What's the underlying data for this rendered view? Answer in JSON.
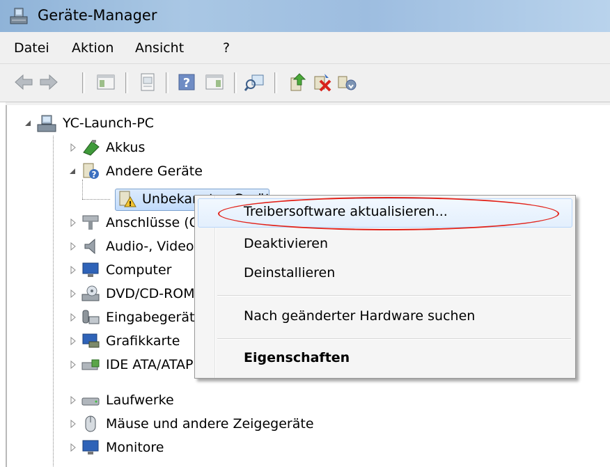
{
  "window": {
    "title": "Geräte-Manager",
    "icon": "device-manager-icon"
  },
  "menubar": {
    "items": [
      "Datei",
      "Aktion",
      "Ansicht",
      "?"
    ]
  },
  "toolbar": {
    "buttons": [
      "back-arrow-icon",
      "forward-arrow-icon",
      "show-hide-console-tree-icon",
      "properties-icon",
      "help-icon",
      "show-action-pane-icon",
      "scan-hardware-icon",
      "update-driver-icon",
      "disable-device-icon",
      "uninstall-device-icon"
    ]
  },
  "tree": {
    "root": "YC-Launch-PC",
    "nodes": [
      {
        "label": "Akkus",
        "icon": "battery-icon"
      },
      {
        "label": "Andere Geräte",
        "icon": "unknown-device-icon",
        "expanded": true
      },
      {
        "label": "Unbekanntes Gerät",
        "icon": "warning-device-icon",
        "selected": true
      },
      {
        "label": "Anschlüsse (COM & LPT)",
        "icon": "port-icon"
      },
      {
        "label": "Audio-, Video- und Gamecontroller",
        "icon": "audio-icon"
      },
      {
        "label": "Computer",
        "icon": "computer-icon"
      },
      {
        "label": "DVD/CD-ROM-Laufwerke",
        "icon": "dvd-drive-icon"
      },
      {
        "label": "Eingabegeräte (Human Interface Devices)",
        "icon": "input-device-icon"
      },
      {
        "label": "Grafikkarte",
        "icon": "display-adapter-icon"
      },
      {
        "label": "IDE ATA/ATAPI-Controller",
        "icon": "ide-controller-icon"
      },
      {
        "label": "Laufwerke",
        "icon": "disk-drive-icon"
      },
      {
        "label": "Mäuse und andere Zeigegeräte",
        "icon": "mouse-icon"
      },
      {
        "label": "Monitore",
        "icon": "monitor-icon"
      }
    ]
  },
  "context_menu": {
    "items": [
      "Treibersoftware aktualisieren...",
      "Deaktivieren",
      "Deinstallieren",
      "Nach geänderter Hardware suchen",
      "Eigenschaften"
    ],
    "highlighted": "Treibersoftware aktualisieren...",
    "annotation_color": "#e2231a"
  }
}
